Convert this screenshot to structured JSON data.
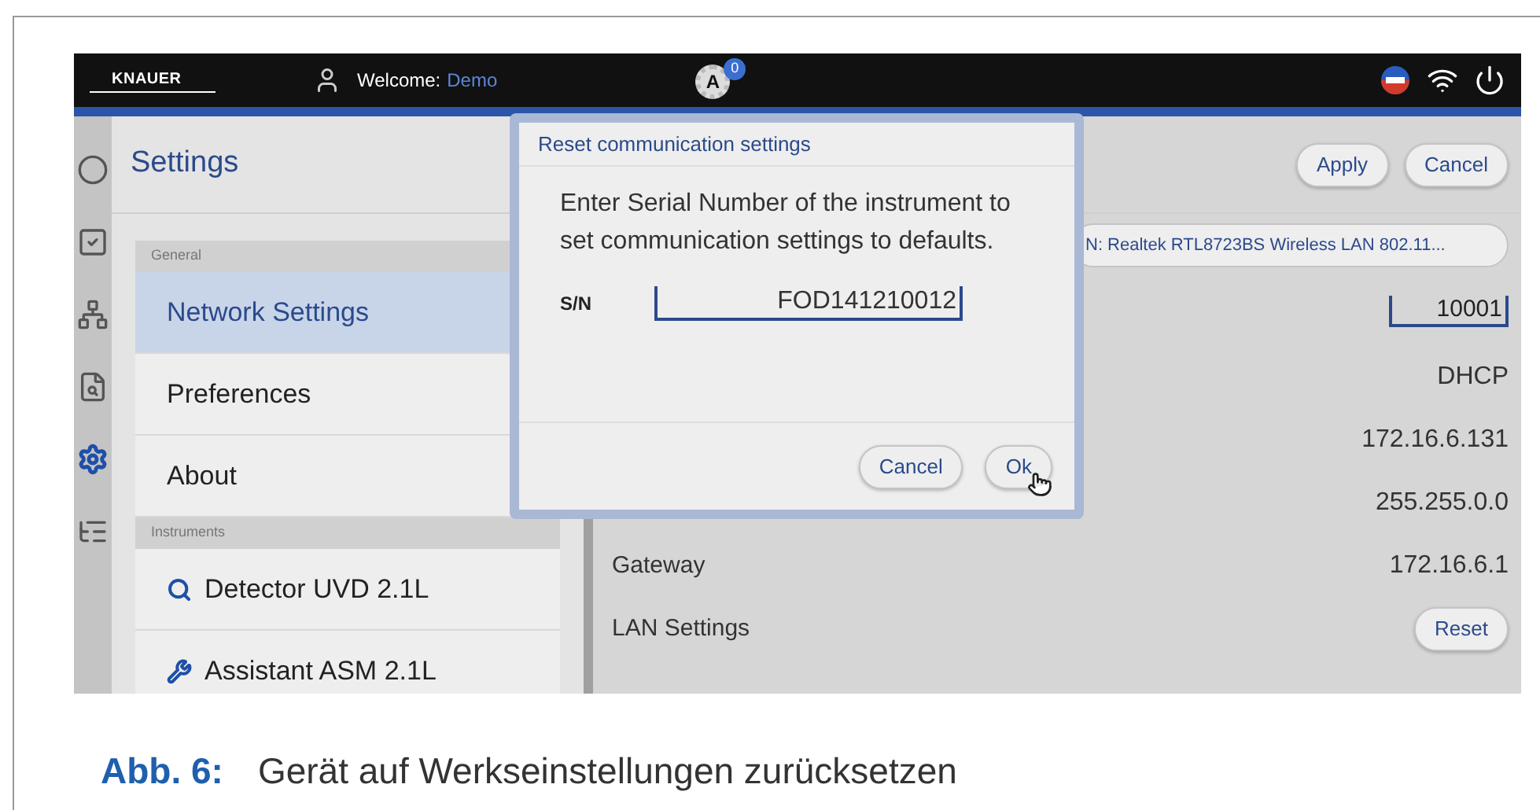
{
  "app_bar": {
    "logo": "KNAUER",
    "welcome_label": "Welcome:",
    "user": "Demo",
    "mode_letter": "A",
    "notification_count": "0"
  },
  "nav_rail": [
    {
      "kind": "status",
      "selected": false
    },
    {
      "kind": "tasks",
      "selected": false
    },
    {
      "kind": "network",
      "selected": false
    },
    {
      "kind": "inspect",
      "selected": false
    },
    {
      "kind": "settings",
      "selected": true
    },
    {
      "kind": "list",
      "selected": false
    }
  ],
  "settings": {
    "title": "Settings",
    "groups": [
      {
        "header": "General",
        "items": [
          {
            "label": "Network Settings",
            "kind": "plain",
            "selected": true
          },
          {
            "label": "Preferences",
            "kind": "plain",
            "selected": false
          },
          {
            "label": "About",
            "kind": "plain",
            "selected": false
          }
        ]
      },
      {
        "header": "Instruments",
        "items": [
          {
            "label": "Detector UVD 2.1L",
            "kind": "detector",
            "selected": false
          },
          {
            "label": "Assistant ASM 2.1L",
            "kind": "assistant",
            "selected": false
          }
        ]
      }
    ]
  },
  "network": {
    "buttons": [
      "Apply",
      "Cancel"
    ],
    "adapter": "N: Realtek RTL8723BS Wireless LAN 802.11...",
    "port": "10001",
    "rows": [
      {
        "value": "DHCP"
      },
      {
        "value": "172.16.6.131"
      },
      {
        "value": "255.255.0.0"
      },
      {
        "label": "Gateway",
        "value": "172.16.6.1"
      },
      {
        "label": "LAN Settings",
        "action": "Reset"
      }
    ]
  },
  "dialog": {
    "title": "Reset communication settings",
    "message": "Enter Serial Number of the instrument to set communication settings to defaults.",
    "field_label": "S/N",
    "serial": "FOD141210012",
    "buttons": [
      "Cancel",
      "Ok"
    ]
  },
  "caption": {
    "number": "Abb. 6:",
    "text": "Gerät auf Werkseinstellungen zurücksetzen"
  }
}
